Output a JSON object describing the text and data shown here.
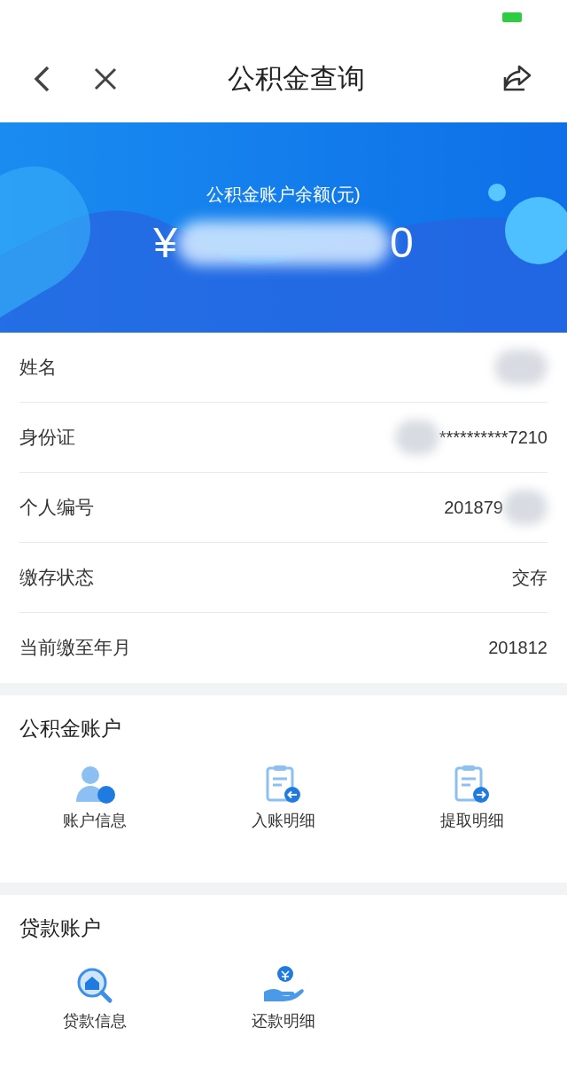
{
  "header": {
    "title": "公积金查询"
  },
  "banner": {
    "label": "公积金账户余额(元)",
    "currency": "¥",
    "amount_end": "0"
  },
  "info_rows": [
    {
      "label": "姓名",
      "value_prefix": "",
      "value": "",
      "blurred": true
    },
    {
      "label": "身份证",
      "value_prefix": "",
      "value": "**********7210",
      "blurred": true
    },
    {
      "label": "个人编号",
      "value_prefix": "201879",
      "value": "",
      "blurred": true
    },
    {
      "label": "缴存状态",
      "value_prefix": "",
      "value": "交存",
      "blurred": false
    },
    {
      "label": "当前缴至年月",
      "value_prefix": "",
      "value": "201812",
      "blurred": false
    }
  ],
  "sections": [
    {
      "title": "公积金账户",
      "items": [
        {
          "kind": "account",
          "label": "账户信息"
        },
        {
          "kind": "deposit",
          "label": "入账明细"
        },
        {
          "kind": "withdraw",
          "label": "提取明细"
        }
      ]
    },
    {
      "title": "贷款账户",
      "items": [
        {
          "kind": "loan",
          "label": "贷款信息"
        },
        {
          "kind": "repay",
          "label": "还款明细"
        }
      ]
    }
  ]
}
